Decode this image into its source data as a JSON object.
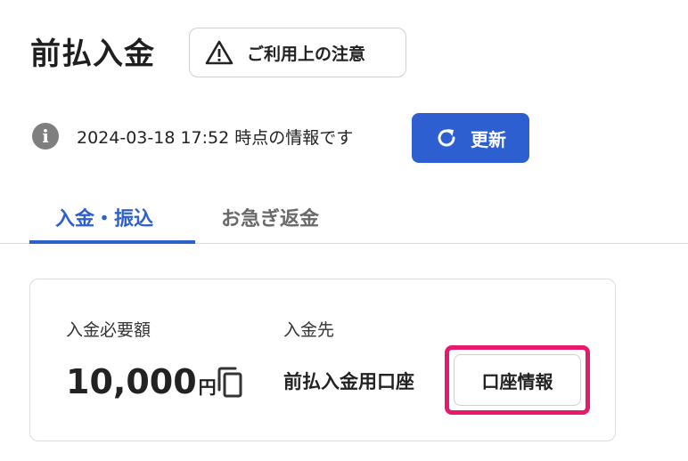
{
  "header": {
    "title": "前払入金",
    "notice_button_label": "ご利用上の注意",
    "notice_icon": "warning-triangle-icon"
  },
  "status": {
    "info_icon": "info-icon",
    "timestamp_text": "2024-03-18 17:52 時点の情報です",
    "refresh_label": "更新",
    "refresh_icon": "refresh-icon"
  },
  "tabs": [
    {
      "label": "入金・振込",
      "active": true
    },
    {
      "label": "お急ぎ返金",
      "active": false
    }
  ],
  "card": {
    "amount_label": "入金必要額",
    "amount_value": "10,000",
    "amount_unit": "円",
    "copy_icon": "copy-icon",
    "destination_label": "入金先",
    "destination_value": "前払入金用口座",
    "account_info_button": "口座情報"
  },
  "colors": {
    "accent": "#2e5fd1",
    "highlight": "#e8196a",
    "info_icon_bg": "#7f7f7f",
    "border": "#dddddd"
  }
}
